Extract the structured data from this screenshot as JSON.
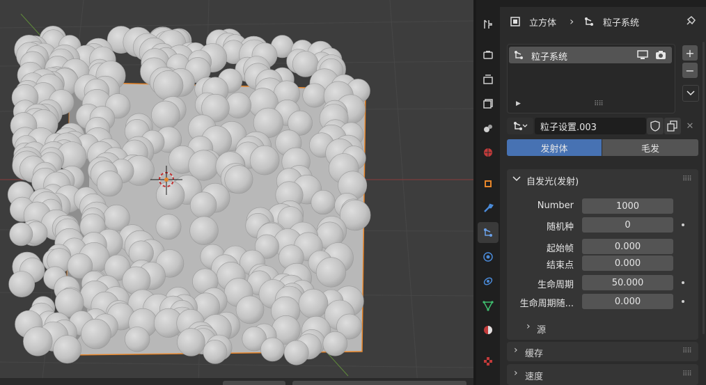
{
  "breadcrumb": {
    "object": "立方体",
    "separator": "›",
    "section": "粒子系统"
  },
  "particle_list": {
    "items": [
      {
        "label": "粒子系统"
      }
    ]
  },
  "settings_selector": {
    "name": "粒子设置.003"
  },
  "type_toggle": {
    "options": [
      "发射体",
      "毛发"
    ],
    "active": "发射体"
  },
  "emission_panel": {
    "title": "自发光(发射)",
    "rows": [
      {
        "label": "Number",
        "value": "1000",
        "animatable": false
      },
      {
        "label": "随机种",
        "value": "0",
        "animatable": true
      },
      {
        "label": "起始帧",
        "value": "0.000",
        "animatable": false
      },
      {
        "label": "结束点",
        "value": "0.000",
        "animatable": false
      },
      {
        "label": "生命周期",
        "value": "50.000",
        "animatable": true
      },
      {
        "label": "生命周期随...",
        "value": "0.000",
        "animatable": true
      }
    ],
    "subpanel": "源"
  },
  "collapsed_panels": [
    "缓存",
    "速度"
  ],
  "colors": {
    "accent": "#4772b3",
    "viewport_bg": "#3d3d3d",
    "panel_bg": "#2b2b2b",
    "selection_outline": "#e8862a"
  },
  "property_tabs": [
    "tool-icon",
    "render-icon",
    "output-icon",
    "view-layer-icon",
    "scene-icon",
    "world-icon",
    "object-icon",
    "modifier-icon",
    "particles-icon",
    "physics-icon",
    "constraints-icon",
    "data-icon",
    "material-icon",
    "texture-icon"
  ]
}
